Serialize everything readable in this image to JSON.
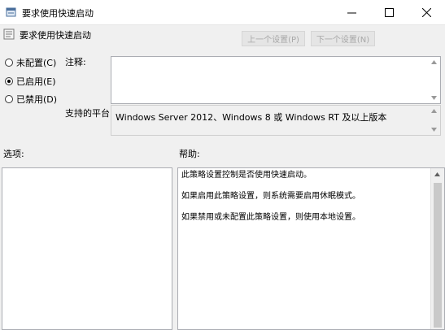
{
  "window": {
    "title": "要求使用快速启动"
  },
  "header": {
    "title": "要求使用快速启动"
  },
  "nav": {
    "prev_label": "上一个设置(P)",
    "next_label": "下一个设置(N)"
  },
  "options": [
    {
      "label": "未配置(C)",
      "selected": false
    },
    {
      "label": "已启用(E)",
      "selected": true
    },
    {
      "label": "已禁用(D)",
      "selected": false
    }
  ],
  "comment": {
    "label": "注释:",
    "value": ""
  },
  "platform": {
    "label": "支持的平台:",
    "value": "Windows Server 2012、Windows 8 或 Windows RT 及以上版本"
  },
  "options_section": {
    "label": "选项:"
  },
  "help_section": {
    "label": "帮助:",
    "paragraphs": [
      "此策略设置控制是否使用快速启动。",
      "如果启用此策略设置，则系统需要启用休眠模式。",
      "如果禁用或未配置此策略设置，则使用本地设置。"
    ]
  }
}
